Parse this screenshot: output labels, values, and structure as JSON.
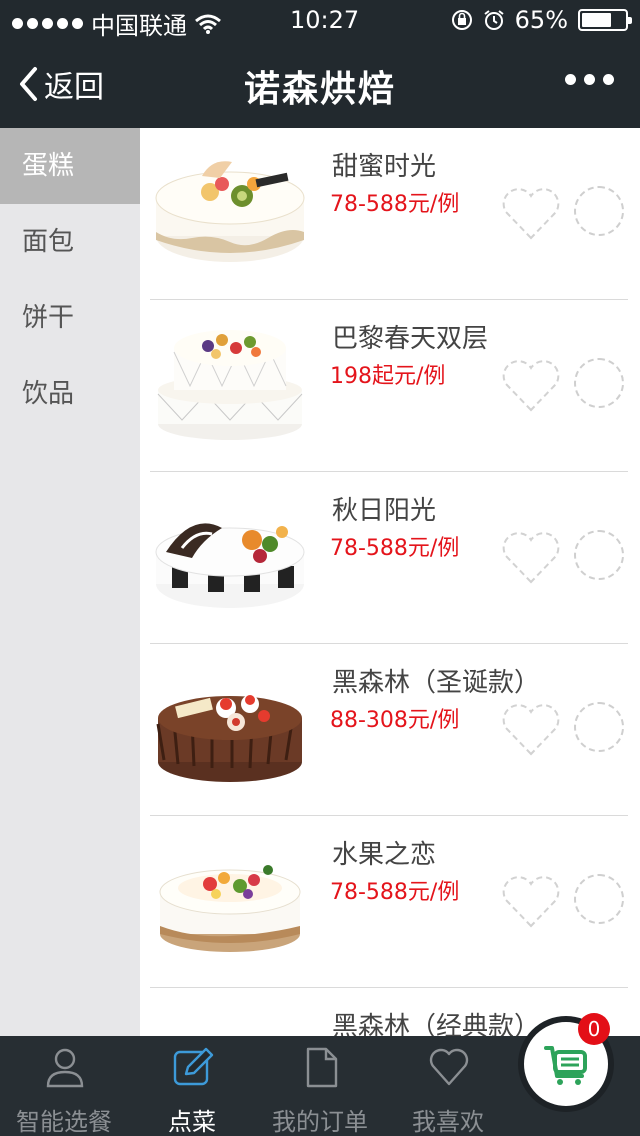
{
  "status_bar": {
    "carrier": "中国联通",
    "time": "10:27",
    "battery": "65%",
    "battery_level": 0.65
  },
  "nav": {
    "back_label": "返回",
    "title": "诺森烘焙"
  },
  "categories": [
    {
      "label": "蛋糕",
      "active": true
    },
    {
      "label": "面包",
      "active": false
    },
    {
      "label": "饼干",
      "active": false
    },
    {
      "label": "饮品",
      "active": false
    }
  ],
  "products": [
    {
      "name": "甜蜜时光",
      "price": "78-588元/例"
    },
    {
      "name": "巴黎春天双层",
      "price": "198起元/例"
    },
    {
      "name": "秋日阳光",
      "price": "78-588元/例"
    },
    {
      "name": "黑森林（圣诞款）",
      "price": "88-308元/例"
    },
    {
      "name": "水果之恋",
      "price": "78-588元/例"
    },
    {
      "name": "黑森林（经典款）",
      "price": ""
    }
  ],
  "tabs": [
    {
      "label": "智能选餐",
      "icon": "person-icon",
      "active": false
    },
    {
      "label": "点菜",
      "icon": "edit-icon",
      "active": true
    },
    {
      "label": "我的订单",
      "icon": "document-icon",
      "active": false
    },
    {
      "label": "我喜欢",
      "icon": "heart-icon",
      "active": false
    }
  ],
  "cart": {
    "count": "0",
    "icon": "cart-icon"
  },
  "colors": {
    "accent": "#3d9ad9",
    "price": "#e4141b",
    "cart": "#2da35a",
    "badge": "#e30f17",
    "bar": "#22292e"
  }
}
